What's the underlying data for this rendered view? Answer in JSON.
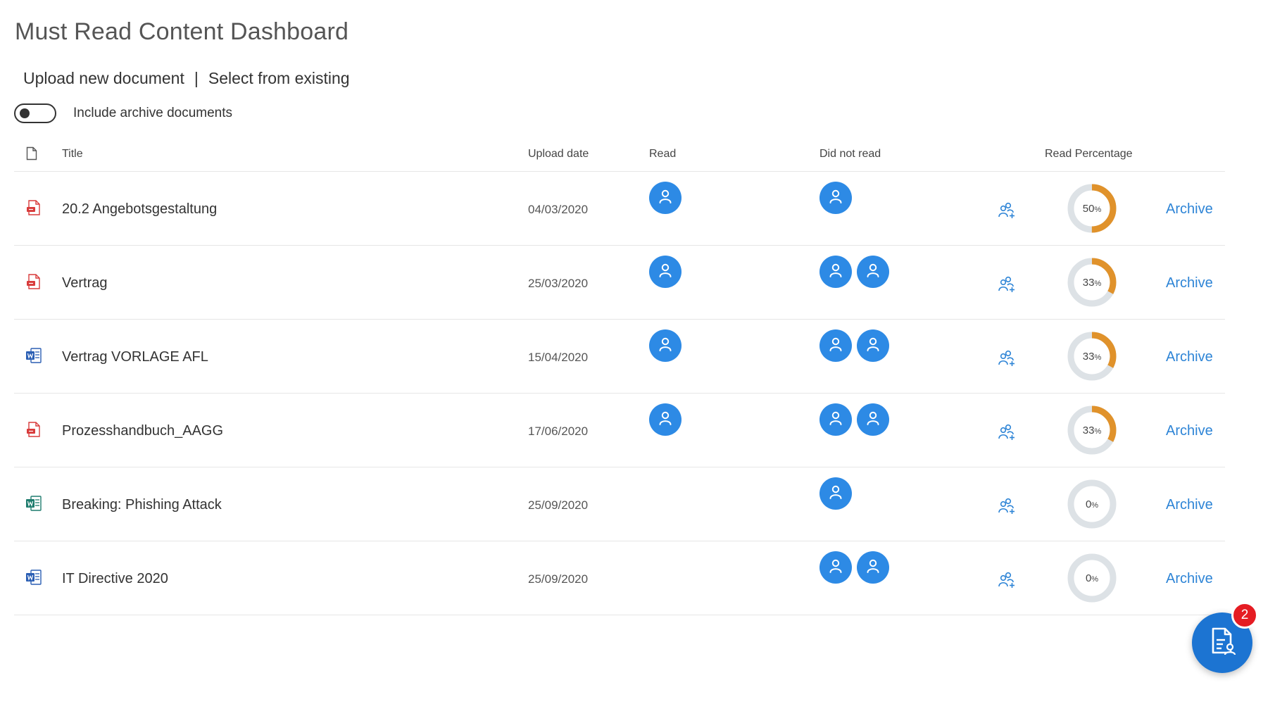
{
  "page_title": "Must Read Content Dashboard",
  "actions": {
    "upload_label": "Upload new document",
    "separator": "|",
    "select_label": "Select from existing"
  },
  "archive_toggle": {
    "label": "Include archive documents",
    "checked": false
  },
  "table": {
    "columns": {
      "file_icon": "file-icon",
      "title": "Title",
      "upload_date": "Upload date",
      "read": "Read",
      "did_not_read": "Did not read",
      "read_percentage": "Read Percentage"
    },
    "rows": [
      {
        "type": "pdf",
        "title": "20.2 Angebotsgestaltung",
        "date": "04/03/2020",
        "read_count": 1,
        "not_read_count": 1,
        "percent": 50,
        "percent_label": "50",
        "percent_unit": "%",
        "action": "Archive"
      },
      {
        "type": "pdf",
        "title": "Vertrag",
        "date": "25/03/2020",
        "read_count": 1,
        "not_read_count": 2,
        "percent": 33,
        "percent_label": "33",
        "percent_unit": "%",
        "action": "Archive"
      },
      {
        "type": "word",
        "title": "Vertrag VORLAGE AFL",
        "date": "15/04/2020",
        "read_count": 1,
        "not_read_count": 2,
        "percent": 33,
        "percent_label": "33",
        "percent_unit": "%",
        "action": "Archive"
      },
      {
        "type": "pdf",
        "title": "Prozesshandbuch_AAGG",
        "date": "17/06/2020",
        "read_count": 1,
        "not_read_count": 2,
        "percent": 33,
        "percent_label": "33",
        "percent_unit": "%",
        "action": "Archive"
      },
      {
        "type": "sway",
        "title": "Breaking: Phishing Attack",
        "date": "25/09/2020",
        "read_count": 0,
        "not_read_count": 1,
        "percent": 0,
        "percent_label": "0",
        "percent_unit": "%",
        "action": "Archive"
      },
      {
        "type": "word",
        "title": "IT Directive 2020",
        "date": "25/09/2020",
        "read_count": 0,
        "not_read_count": 2,
        "percent": 0,
        "percent_label": "0",
        "percent_unit": "%",
        "action": "Archive"
      }
    ]
  },
  "fab": {
    "icon": "document-reader-icon",
    "badge_count": "2"
  },
  "colors": {
    "accent": "#2d8ae5",
    "link": "#2d84d6",
    "donut_fill": "#e0922b",
    "donut_track": "#dde2e6",
    "badge": "#e51c23",
    "pdf": "#d83b3b",
    "word": "#2b5fb4",
    "sway": "#1f7c6e"
  }
}
